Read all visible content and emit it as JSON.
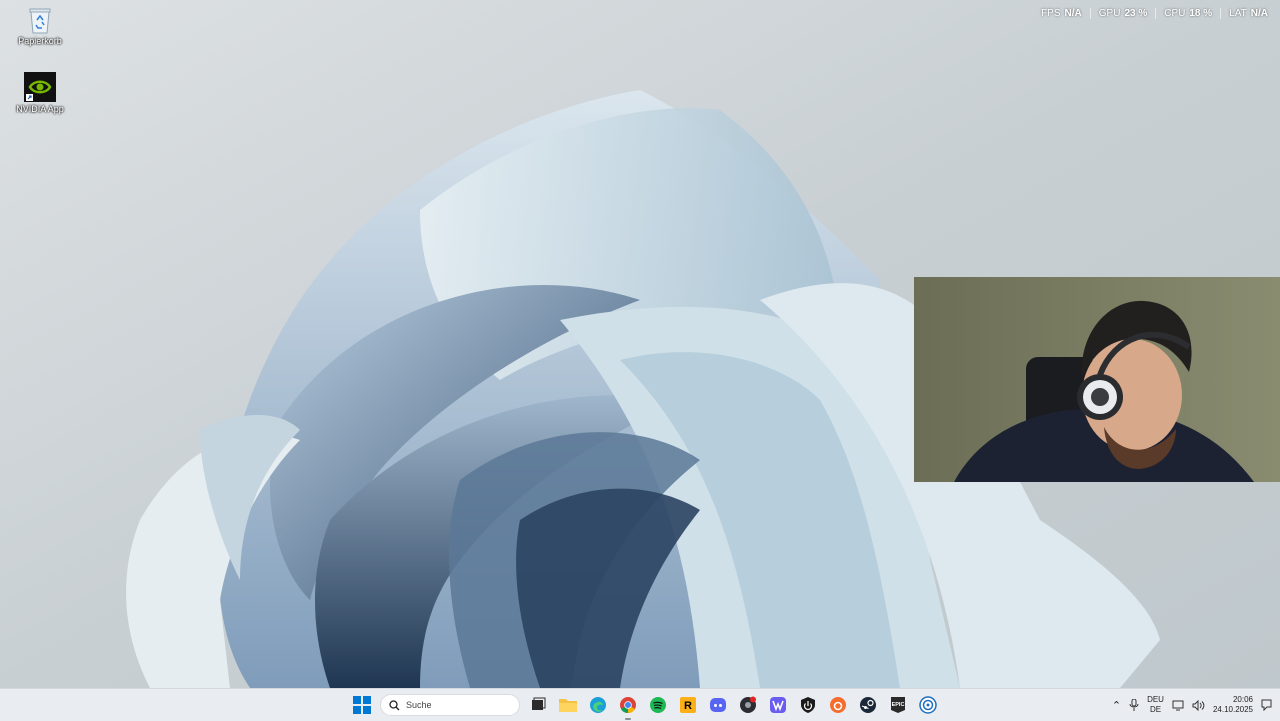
{
  "desktop": {
    "icons": [
      {
        "label": "Papierkorb",
        "icon": "recycle-bin-icon"
      },
      {
        "label": "NVIDIA App",
        "icon": "nvidia-icon"
      }
    ]
  },
  "perf_overlay": {
    "fps": {
      "label": "FPS",
      "value": "N/A"
    },
    "gpu": {
      "label": "GPU",
      "value": "23 %"
    },
    "cpu": {
      "label": "CPU",
      "value": "18 %"
    },
    "lat": {
      "label": "LAT",
      "value": "N/A"
    }
  },
  "taskbar": {
    "search_placeholder": "Suche",
    "apps": [
      "start-icon",
      "task-view-icon",
      "file-explorer-icon",
      "edge-icon",
      "chrome-icon",
      "spotify-icon",
      "rockstar-icon",
      "discord-icon",
      "game-launcher-icon",
      "app-icon",
      "shield-app-icon",
      "origin-icon",
      "steam-icon",
      "epic-games-icon",
      "ubisoft-icon"
    ],
    "tray": {
      "lang_top": "DEU",
      "lang_bottom": "DE",
      "time": "20:06",
      "date": "24.10.2025"
    }
  },
  "colors": {
    "taskbar_bg": "#e9edf1",
    "accent": "#0078d4"
  }
}
